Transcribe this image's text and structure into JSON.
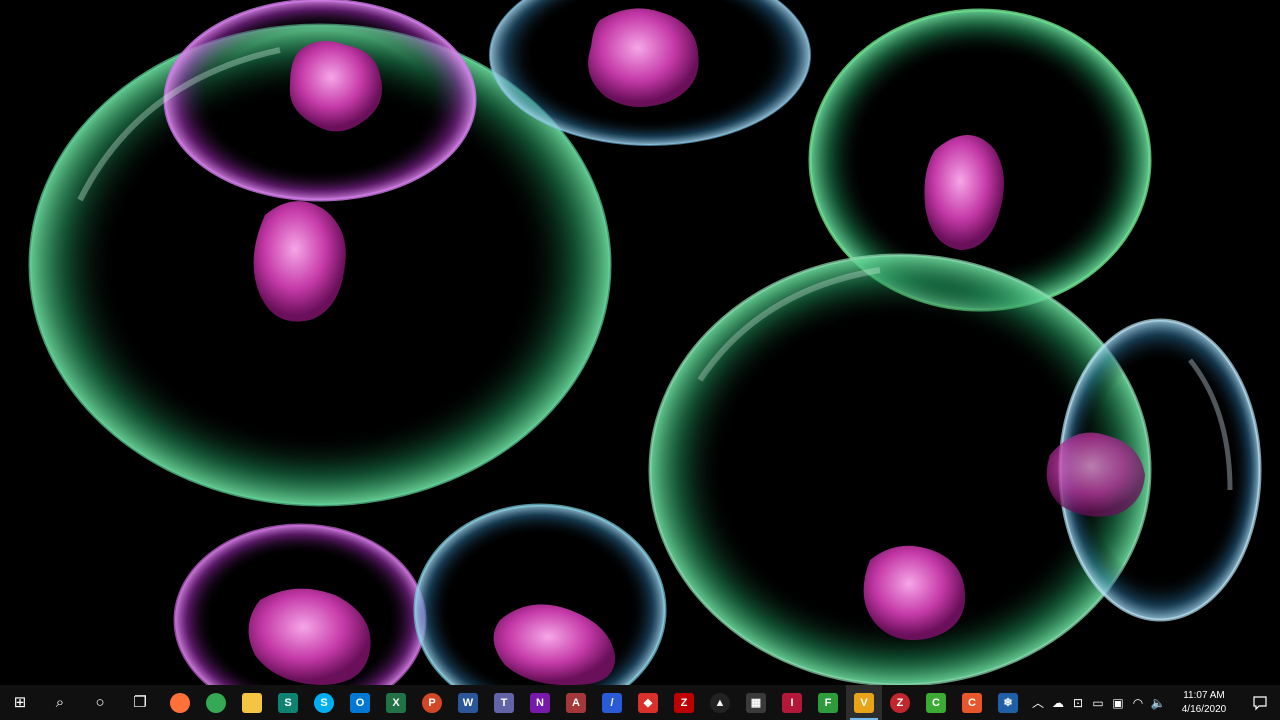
{
  "taskbar": {
    "system_buttons": [
      {
        "name": "start-button",
        "icon": "windows-logo-icon",
        "glyph": "⊞"
      },
      {
        "name": "search-button",
        "icon": "search-icon",
        "glyph": "⌕"
      },
      {
        "name": "cortana-button",
        "icon": "cortana-ring-icon",
        "glyph": "○"
      },
      {
        "name": "task-view-button",
        "icon": "task-view-icon",
        "glyph": "❐"
      }
    ],
    "apps": [
      {
        "name": "firefox",
        "icon": "firefox-icon",
        "letter": "",
        "color": "#ff7139",
        "shape": "round"
      },
      {
        "name": "chrome",
        "icon": "chrome-icon",
        "letter": "",
        "color": "#34a853",
        "shape": "round"
      },
      {
        "name": "file-explorer",
        "icon": "folder-icon",
        "letter": "",
        "color": "#f4c542",
        "shape": "square"
      },
      {
        "name": "sway",
        "icon": "sway-icon",
        "letter": "S",
        "color": "#108272",
        "shape": "square"
      },
      {
        "name": "skype",
        "icon": "skype-icon",
        "letter": "S",
        "color": "#00aff0",
        "shape": "round"
      },
      {
        "name": "outlook",
        "icon": "outlook-icon",
        "letter": "O",
        "color": "#0078d4",
        "shape": "square"
      },
      {
        "name": "excel",
        "icon": "excel-icon",
        "letter": "X",
        "color": "#217346",
        "shape": "square"
      },
      {
        "name": "powerpoint",
        "icon": "powerpoint-icon",
        "letter": "P",
        "color": "#d24726",
        "shape": "round"
      },
      {
        "name": "word",
        "icon": "word-icon",
        "letter": "W",
        "color": "#2b579a",
        "shape": "square"
      },
      {
        "name": "teams",
        "icon": "teams-icon",
        "letter": "T",
        "color": "#6264a7",
        "shape": "square"
      },
      {
        "name": "onenote",
        "icon": "onenote-icon",
        "letter": "N",
        "color": "#7719aa",
        "shape": "square"
      },
      {
        "name": "access",
        "icon": "access-icon",
        "letter": "A",
        "color": "#a4373a",
        "shape": "square"
      },
      {
        "name": "pen-app",
        "icon": "pen-icon",
        "letter": "/",
        "color": "#2a5bd7",
        "shape": "square"
      },
      {
        "name": "shield-app",
        "icon": "shield-icon",
        "letter": "◆",
        "color": "#d9302c",
        "shape": "square"
      },
      {
        "name": "filezilla",
        "icon": "filezilla-icon",
        "letter": "Z",
        "color": "#bf0000",
        "shape": "square"
      },
      {
        "name": "mountain-app",
        "icon": "mountain-icon",
        "letter": "▲",
        "color": "#222222",
        "shape": "round"
      },
      {
        "name": "calculator",
        "icon": "calculator-icon",
        "letter": "▦",
        "color": "#3a3a3a",
        "shape": "square"
      },
      {
        "name": "app-i",
        "icon": "app-i-icon",
        "letter": "I",
        "color": "#b3173a",
        "shape": "square"
      },
      {
        "name": "app-f",
        "icon": "app-f-icon",
        "letter": "F",
        "color": "#2e9c3a",
        "shape": "square"
      },
      {
        "name": "app-v",
        "icon": "app-v-icon",
        "letter": "V",
        "color": "#e8a317",
        "shape": "square",
        "active": true
      },
      {
        "name": "app-z",
        "icon": "app-z-icon",
        "letter": "Z",
        "color": "#c2272d",
        "shape": "round"
      },
      {
        "name": "camtasia-green",
        "icon": "c-green-icon",
        "letter": "C",
        "color": "#3daa35",
        "shape": "square"
      },
      {
        "name": "camtasia-orange",
        "icon": "c-orange-icon",
        "letter": "C",
        "color": "#e8572b",
        "shape": "square"
      },
      {
        "name": "snowflake-app",
        "icon": "snowflake-icon",
        "letter": "❄",
        "color": "#1f5fa8",
        "shape": "square"
      }
    ],
    "tray": [
      {
        "name": "show-hidden-icons",
        "icon": "chevron-up-icon",
        "glyph": "︿"
      },
      {
        "name": "onedrive",
        "icon": "cloud-icon",
        "glyph": "☁"
      },
      {
        "name": "network-share",
        "icon": "network-icon",
        "glyph": "⊡"
      },
      {
        "name": "battery",
        "icon": "battery-icon",
        "glyph": "▭"
      },
      {
        "name": "display",
        "icon": "monitor-icon",
        "glyph": "▣"
      },
      {
        "name": "wifi",
        "icon": "wifi-icon",
        "glyph": "◠"
      },
      {
        "name": "volume",
        "icon": "volume-icon",
        "glyph": "🔈"
      }
    ],
    "clock": {
      "time": "11:07 AM",
      "date": "4/16/2020"
    },
    "notification_icon": "notification-icon"
  }
}
